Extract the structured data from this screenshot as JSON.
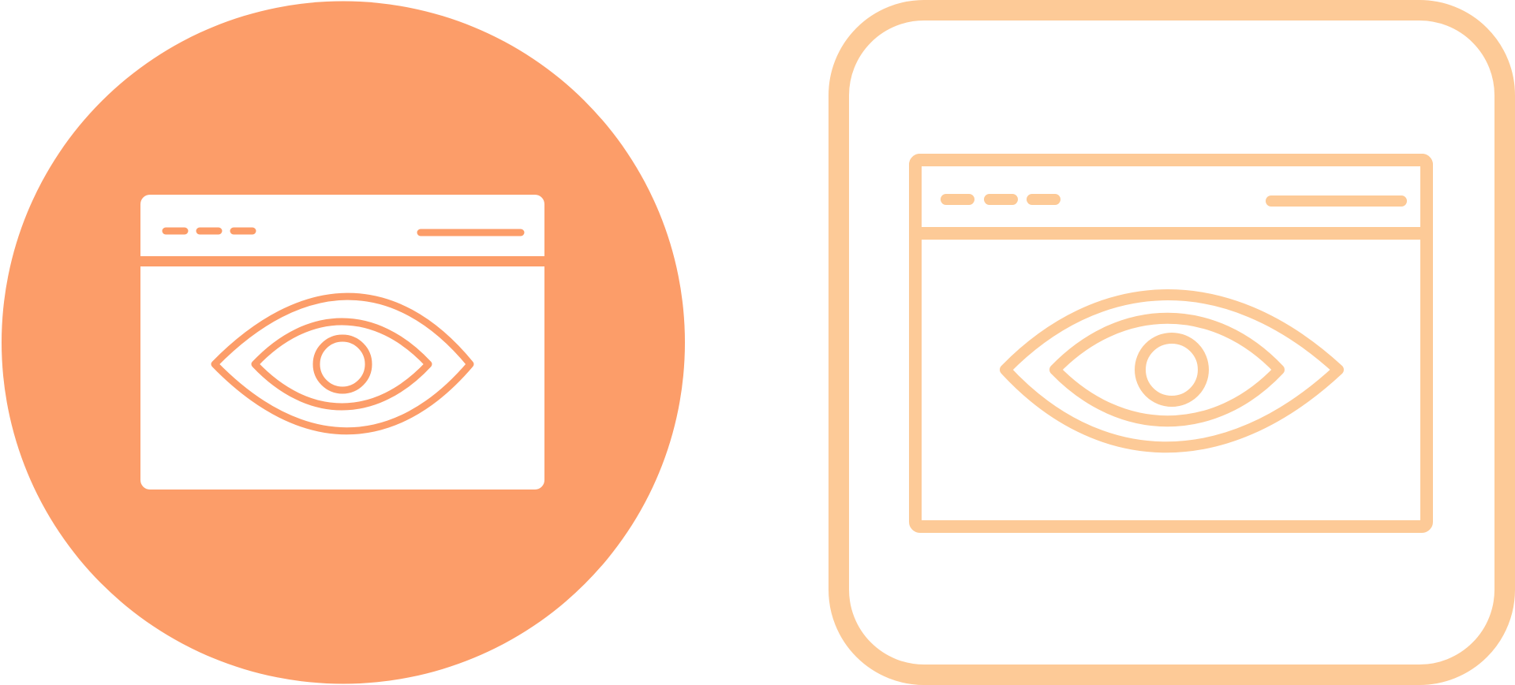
{
  "icons": [
    {
      "name": "browser-eye-icon-filled",
      "style": "filled-circle",
      "colors": {
        "background": "#FC9D69",
        "foreground": "#FFFFFF"
      }
    },
    {
      "name": "browser-eye-icon-outline",
      "style": "outline-rounded-square",
      "colors": {
        "stroke": "#FDCA97",
        "background": "#FFFFFF"
      }
    }
  ]
}
